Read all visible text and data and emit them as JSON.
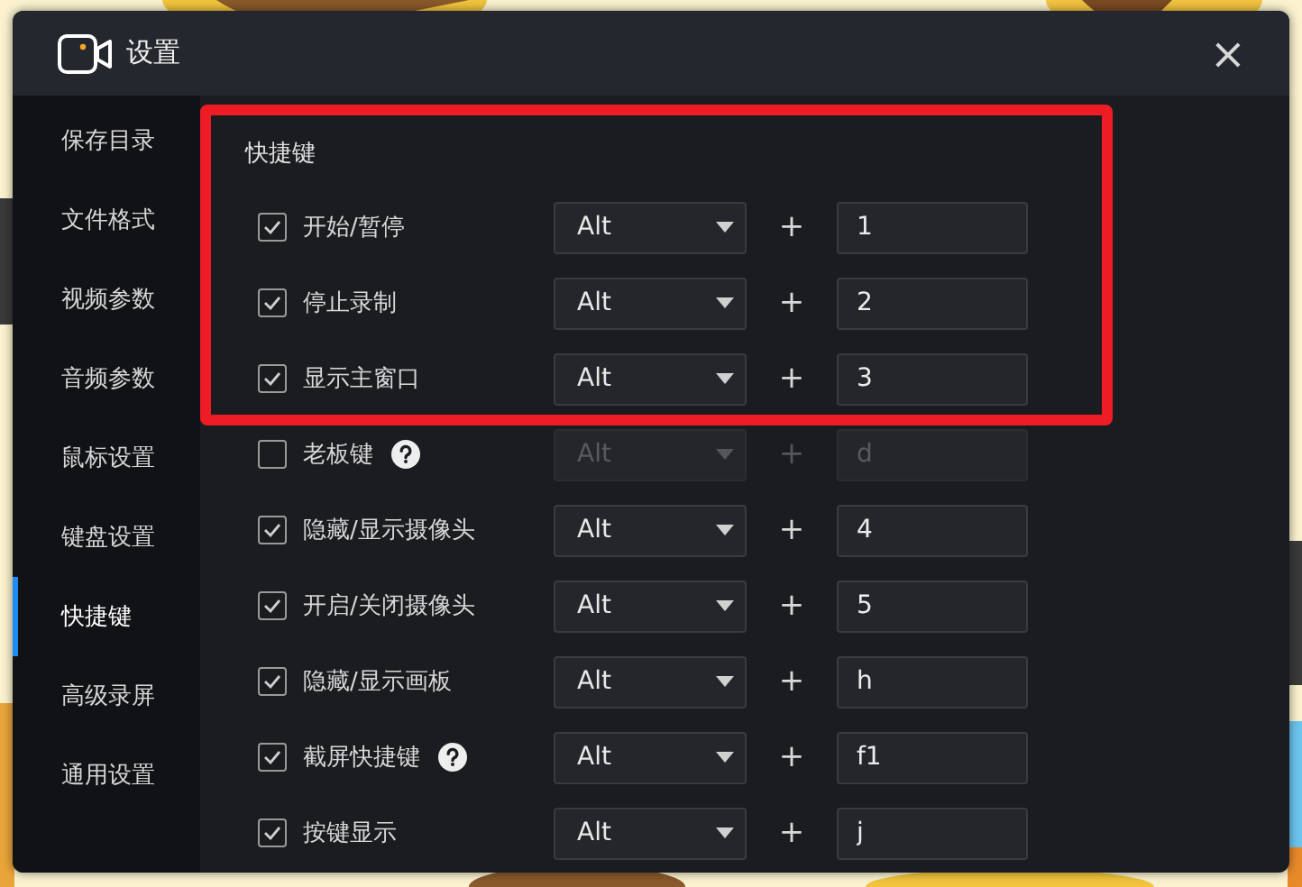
{
  "window": {
    "title": "设置",
    "close": "×"
  },
  "sidebar": {
    "items": [
      {
        "label": "保存目录",
        "selected": false
      },
      {
        "label": "文件格式",
        "selected": false
      },
      {
        "label": "视频参数",
        "selected": false
      },
      {
        "label": "音频参数",
        "selected": false
      },
      {
        "label": "鼠标设置",
        "selected": false
      },
      {
        "label": "键盘设置",
        "selected": false
      },
      {
        "label": "快捷键",
        "selected": true
      },
      {
        "label": "高级录屏",
        "selected": false
      },
      {
        "label": "通用设置",
        "selected": false
      }
    ]
  },
  "section": {
    "title": "快捷键"
  },
  "annotation": {
    "kind": "frame"
  },
  "shortcuts": [
    {
      "label": "开始/暂停",
      "checked": true,
      "disabled": false,
      "help": false,
      "modifier": "Alt",
      "plus": "+",
      "key": "1"
    },
    {
      "label": "停止录制",
      "checked": true,
      "disabled": false,
      "help": false,
      "modifier": "Alt",
      "plus": "+",
      "key": "2"
    },
    {
      "label": "显示主窗口",
      "checked": true,
      "disabled": false,
      "help": false,
      "modifier": "Alt",
      "plus": "+",
      "key": "3"
    },
    {
      "label": "老板键",
      "checked": false,
      "disabled": true,
      "help": true,
      "modifier": "Alt",
      "plus": "+",
      "key": "d"
    },
    {
      "label": "隐藏/显示摄像头",
      "checked": true,
      "disabled": false,
      "help": false,
      "modifier": "Alt",
      "plus": "+",
      "key": "4"
    },
    {
      "label": "开启/关闭摄像头",
      "checked": true,
      "disabled": false,
      "help": false,
      "modifier": "Alt",
      "plus": "+",
      "key": "5"
    },
    {
      "label": "隐藏/显示画板",
      "checked": true,
      "disabled": false,
      "help": false,
      "modifier": "Alt",
      "plus": "+",
      "key": "h"
    },
    {
      "label": "截屏快捷键",
      "checked": true,
      "disabled": false,
      "help": true,
      "modifier": "Alt",
      "plus": "+",
      "key": "f1"
    },
    {
      "label": "按键显示",
      "checked": true,
      "disabled": false,
      "help": false,
      "modifier": "Alt",
      "plus": "+",
      "key": "j"
    }
  ]
}
